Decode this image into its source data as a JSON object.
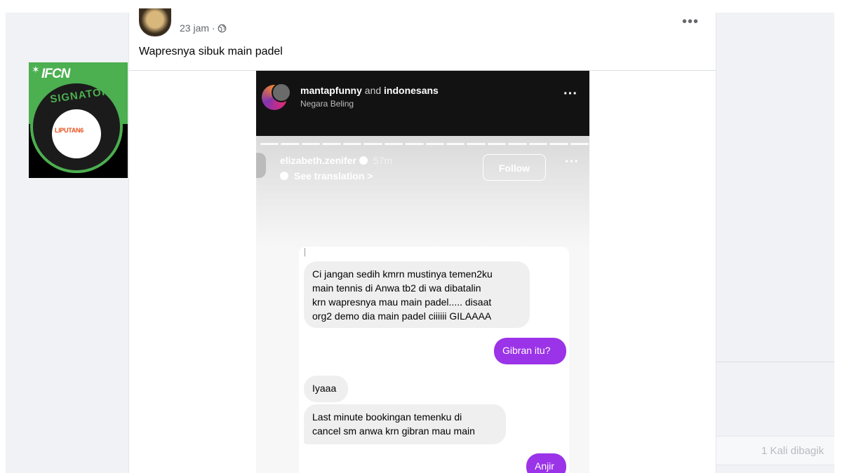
{
  "post": {
    "time": "23 jam · ",
    "globe_icon": "globe-icon",
    "more_icon": "more-horizontal-icon",
    "caption": "Wapresnya sibuk main padel"
  },
  "badge": {
    "ifcn": "IFCN",
    "ifcn_sub": "SIGNATORY",
    "ring": "SIGNATORY",
    "liputan": "LIPUTAN6"
  },
  "sidebar_right": {
    "shares": "1 Kali dibagik"
  },
  "ig": {
    "users_1": "mantapfunny",
    "users_and": " and ",
    "users_2": "indonesans",
    "subtitle": "Negara Beling",
    "story_user": "elizabeth.zenifer",
    "story_time": "57m",
    "see_translation": "See translation >",
    "follow": "Follow",
    "messages": [
      {
        "from": "them",
        "text": "Ci jangan sedih kmrn mustinya temen2ku\nmain tennis di Anwa tb2 di wa dibatalin\nkrn wapresnya mau main padel..... disaat\norg2 demo dia main padel ciiiiii GILAAAA"
      },
      {
        "from": "me",
        "text": "Gibran itu?"
      },
      {
        "from": "them",
        "text": "Iyaaa"
      },
      {
        "from": "them",
        "text": "Last minute bookingan temenku di\ncancel sm anwa krn gibran mau main"
      },
      {
        "from": "me",
        "text": "Anjir"
      }
    ]
  },
  "colors": {
    "outgoing_bubble": "#9b33e8",
    "incoming_bubble": "#efefef",
    "badge_green": "#4caf50"
  }
}
